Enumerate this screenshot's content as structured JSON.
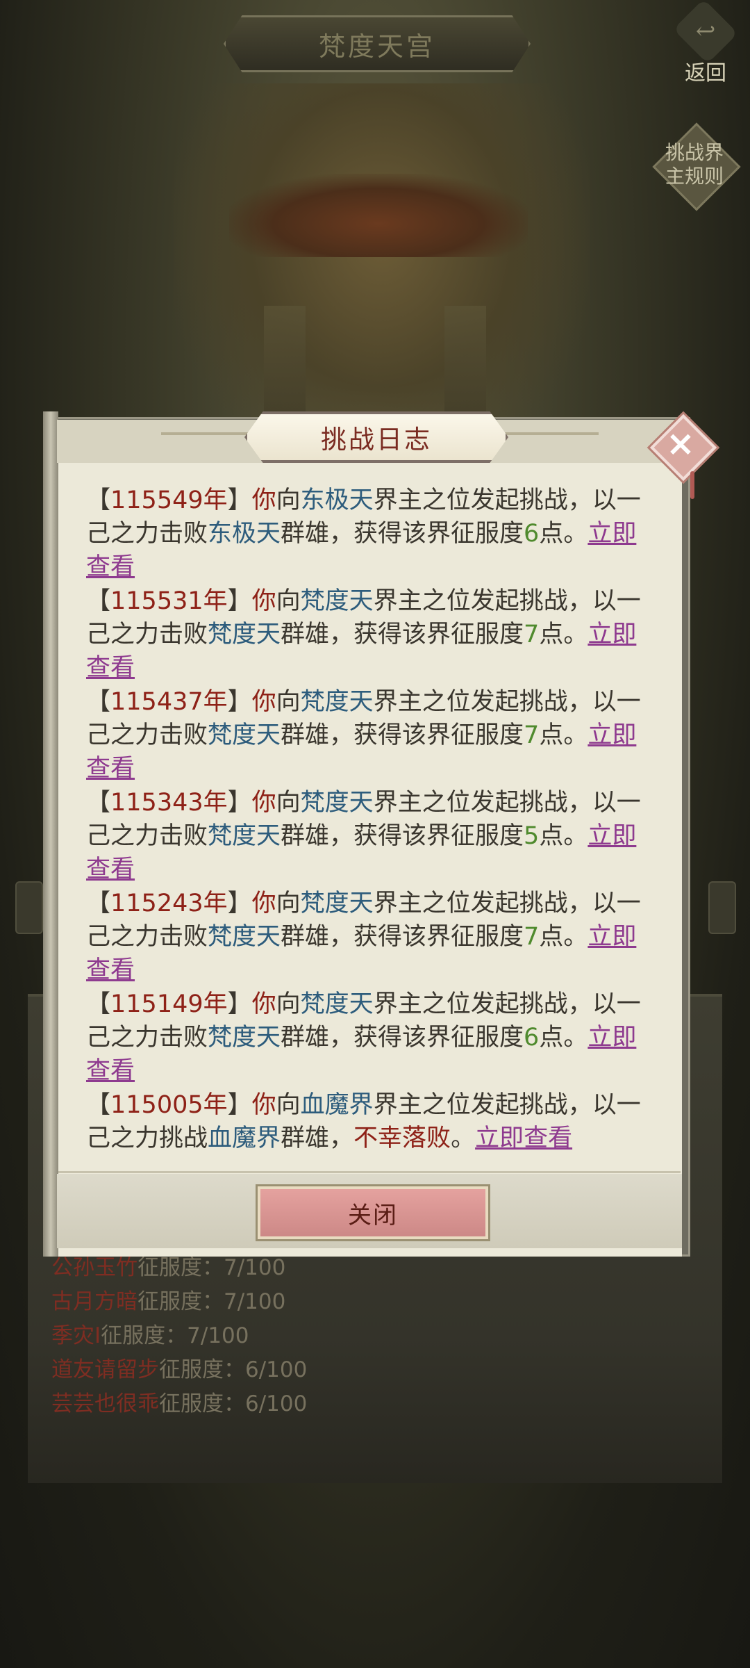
{
  "page": {
    "title": "梵度天宫",
    "back_label": "返回",
    "rules_label_line1": "挑战界",
    "rules_label_line2": "主规则"
  },
  "background_list": [
    {
      "name": "公孙玉竹",
      "rest": "征服度：7/100"
    },
    {
      "name": "古月方暗",
      "rest": "征服度：7/100"
    },
    {
      "name": "季灾I",
      "rest": "征服度：7/100"
    },
    {
      "name": "道友请留步",
      "rest": "征服度：6/100"
    },
    {
      "name": "芸芸也很乖",
      "rest": "征服度：6/100"
    }
  ],
  "dialog": {
    "title": "挑战日志",
    "close_icon": "×",
    "close_button_label": "关闭",
    "entries": [
      {
        "open": "【",
        "year": "115549年",
        "close": "】",
        "you": "你",
        "p1": "向",
        "realm1": "东极天",
        "p2": "界主之位发起挑战，以一己之力击败",
        "realm2": "东极天",
        "p3": "群雄，获得该界征服度",
        "points": "6",
        "p4": "点。",
        "link": "立即查看"
      },
      {
        "open": "【",
        "year": "115531年",
        "close": "】",
        "you": "你",
        "p1": "向",
        "realm1": "梵度天",
        "p2": "界主之位发起挑战，以一己之力击败",
        "realm2": "梵度天",
        "p3": "群雄，获得该界征服度",
        "points": "7",
        "p4": "点。",
        "link": "立即查看"
      },
      {
        "open": "【",
        "year": "115437年",
        "close": "】",
        "you": "你",
        "p1": "向",
        "realm1": "梵度天",
        "p2": "界主之位发起挑战，以一己之力击败",
        "realm2": "梵度天",
        "p3": "群雄，获得该界征服度",
        "points": "7",
        "p4": "点。",
        "link": "立即查看"
      },
      {
        "open": "【",
        "year": "115343年",
        "close": "】",
        "you": "你",
        "p1": "向",
        "realm1": "梵度天",
        "p2": "界主之位发起挑战，以一己之力击败",
        "realm2": "梵度天",
        "p3": "群雄，获得该界征服度",
        "points": "5",
        "p4": "点。",
        "link": "立即查看"
      },
      {
        "open": "【",
        "year": "115243年",
        "close": "】",
        "you": "你",
        "p1": "向",
        "realm1": "梵度天",
        "p2": "界主之位发起挑战，以一己之力击败",
        "realm2": "梵度天",
        "p3": "群雄，获得该界征服度",
        "points": "7",
        "p4": "点。",
        "link": "立即查看"
      },
      {
        "open": "【",
        "year": "115149年",
        "close": "】",
        "you": "你",
        "p1": "向",
        "realm1": "梵度天",
        "p2": "界主之位发起挑战，以一己之力击败",
        "realm2": "梵度天",
        "p3": "群雄，获得该界征服度",
        "points": "6",
        "p4": "点。",
        "link": "立即查看"
      }
    ],
    "last_entry": {
      "open": "【",
      "year": "115005年",
      "close": "】",
      "you": "你",
      "p1": "向",
      "realm1": "血魔界",
      "p2": "界主之位发起挑战，以一己之力挑战",
      "realm2": "血魔界",
      "p3": "群雄，",
      "fail": "不幸落败",
      "p4": "。",
      "link": "立即查看"
    }
  },
  "colors": {
    "year": "#8e2117",
    "realm": "#2d5c7c",
    "points": "#4f8a2d",
    "link": "#8e3a8f",
    "close_button": "#d6918f"
  },
  "icons": {
    "back": "back-arrow-icon",
    "dialog_close": "close-icon",
    "rules": "rules-diamond-icon"
  }
}
